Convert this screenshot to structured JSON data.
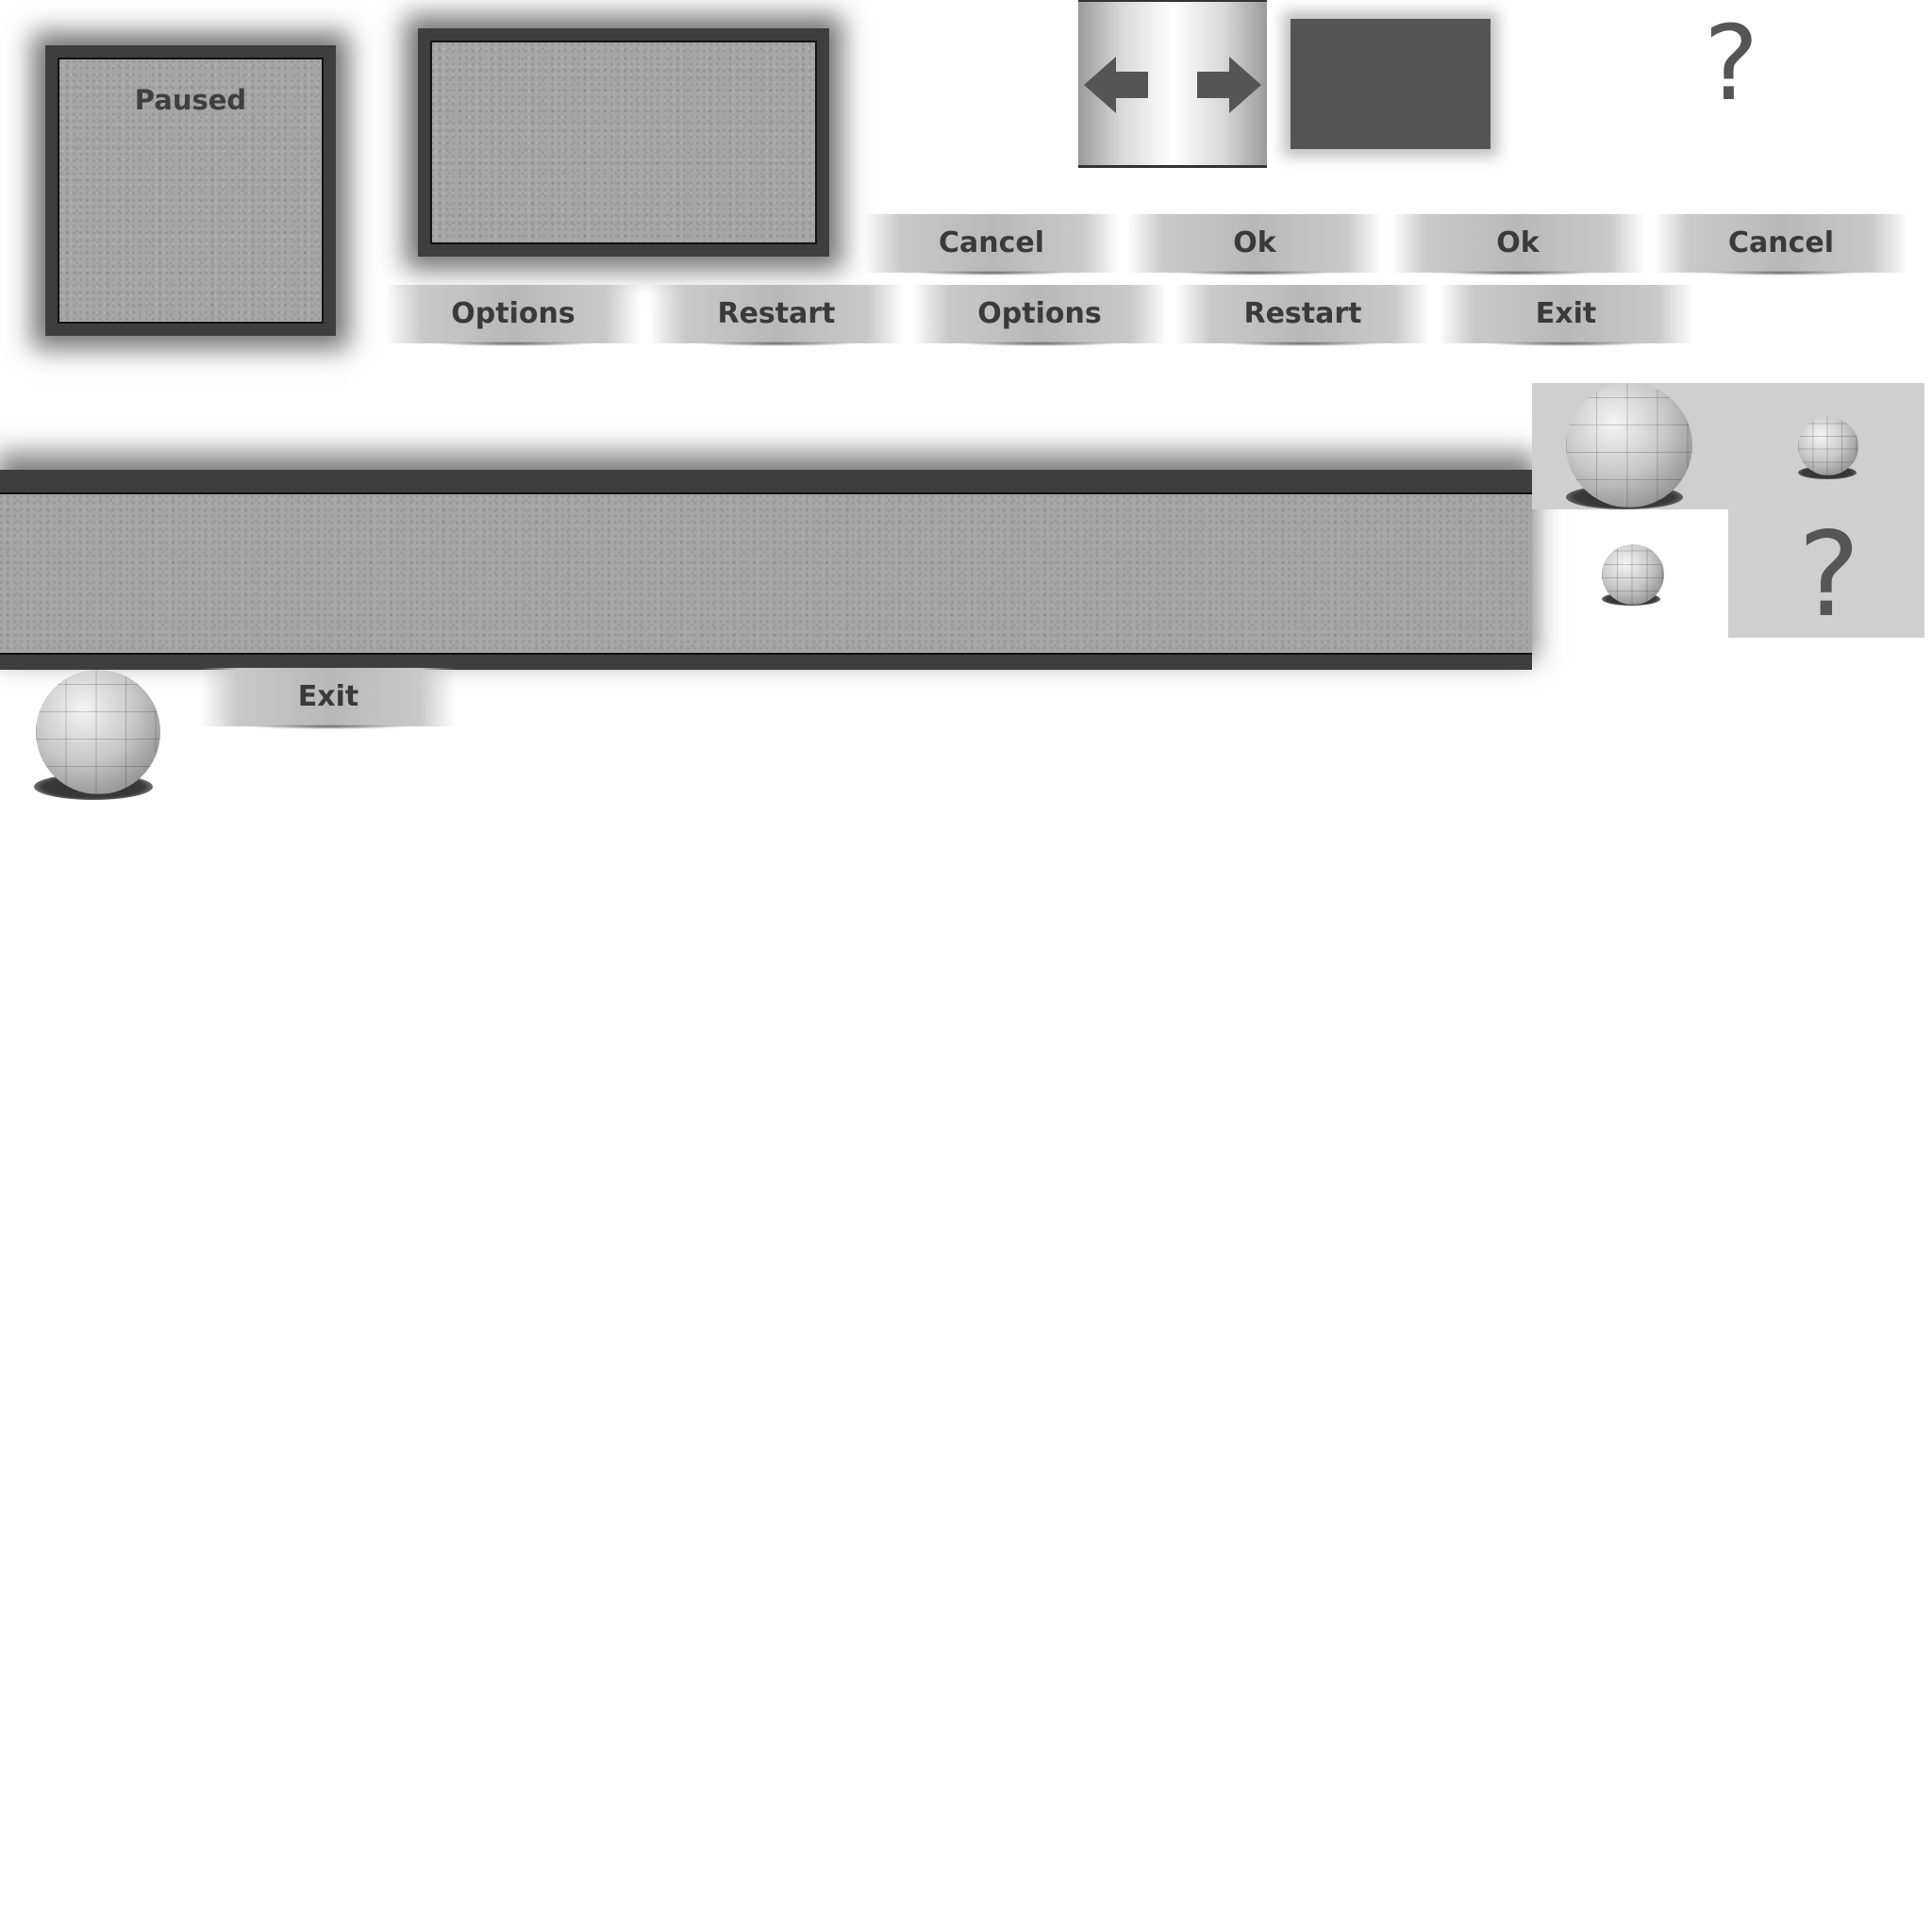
{
  "pause_panel": {
    "title": "Paused"
  },
  "buttons_row1": [
    {
      "label": "Cancel"
    },
    {
      "label": "Ok"
    },
    {
      "label": "Ok"
    },
    {
      "label": "Cancel"
    }
  ],
  "buttons_row2": [
    {
      "label": "Options"
    },
    {
      "label": "Restart"
    },
    {
      "label": "Options"
    },
    {
      "label": "Restart"
    },
    {
      "label": "Exit"
    }
  ],
  "exit_button": {
    "label": "Exit"
  },
  "help_marks": {
    "small": "?",
    "large": "?"
  },
  "icons": {
    "left_arrow": "arrow-left-icon",
    "right_arrow": "arrow-right-icon",
    "sphere": "stone-sphere-icon"
  },
  "colors": {
    "frame": "#3e3e3e",
    "stone": "#a6a6a6",
    "button_text": "#3a3a3a",
    "dark_box": "#555555"
  }
}
